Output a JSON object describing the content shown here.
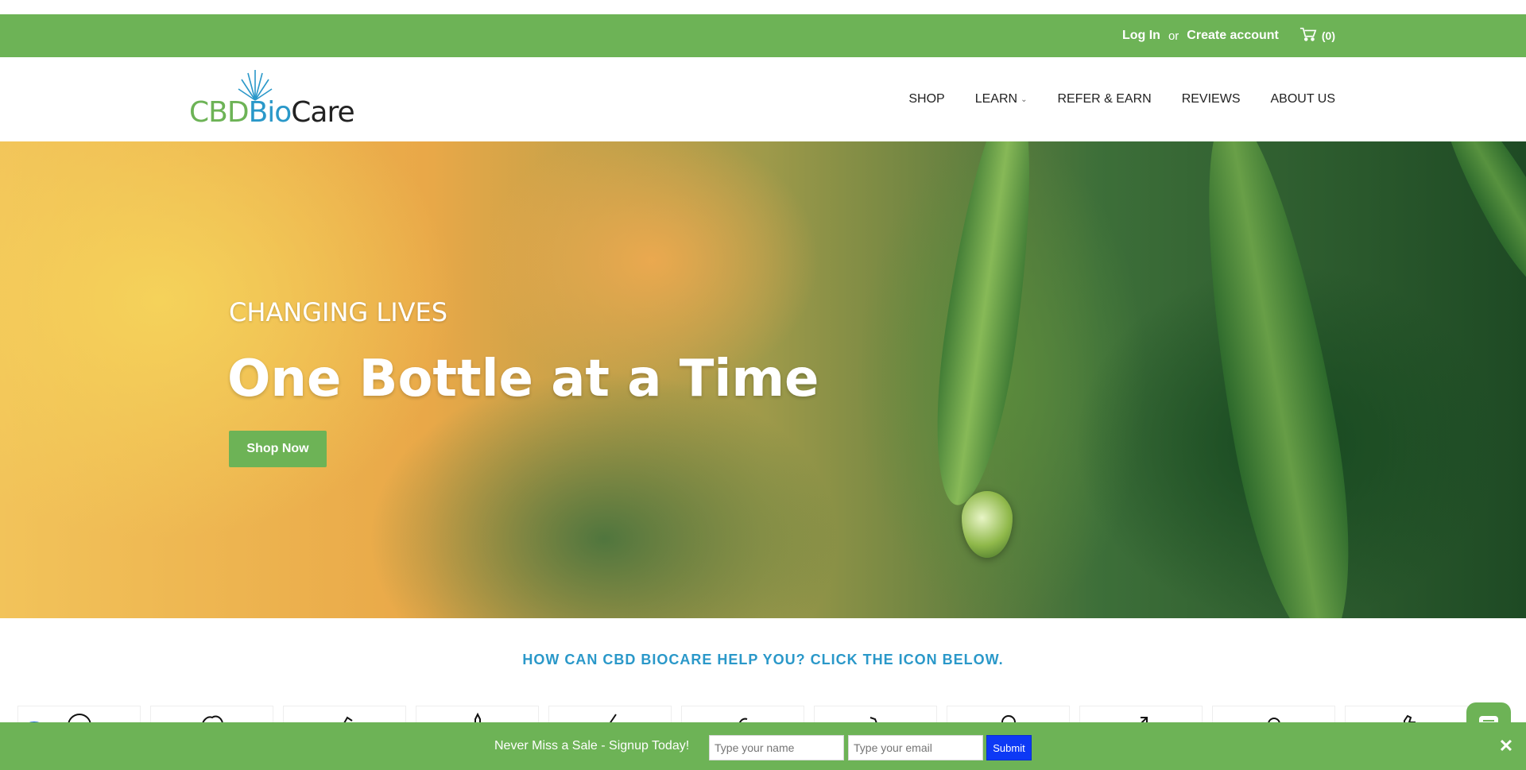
{
  "topbar": {
    "login_label": "Log In",
    "or_label": "or",
    "create_account_label": "Create account",
    "cart_count": "(0)"
  },
  "header": {
    "logo": {
      "cbd": "CBD",
      "bio": "Bio",
      "care": "Care"
    },
    "nav": [
      {
        "label": "SHOP"
      },
      {
        "label": "LEARN"
      },
      {
        "label": "REFER & EARN"
      },
      {
        "label": "REVIEWS"
      },
      {
        "label": "ABOUT US"
      }
    ]
  },
  "hero": {
    "kicker": "CHANGING LIVES",
    "title": "One Bottle at a Time",
    "cta_label": "Shop Now"
  },
  "help": {
    "title": "HOW CAN CBD BIOCARE HELP YOU? CLICK THE ICON BELOW."
  },
  "signup": {
    "text": "Never Miss a Sale - Signup Today!",
    "name_placeholder": "Type your name",
    "email_placeholder": "Type your email",
    "submit_label": "Submit",
    "close_label": "✕"
  },
  "colors": {
    "brand_green": "#6db356",
    "brand_blue": "#2a98c9",
    "submit_blue": "#0d39f5",
    "accessibility_blue": "#1a66d6"
  },
  "icons": {
    "cart": "cart-icon",
    "accessibility": "accessibility-icon",
    "chat": "chat-icon",
    "close": "close-icon"
  }
}
